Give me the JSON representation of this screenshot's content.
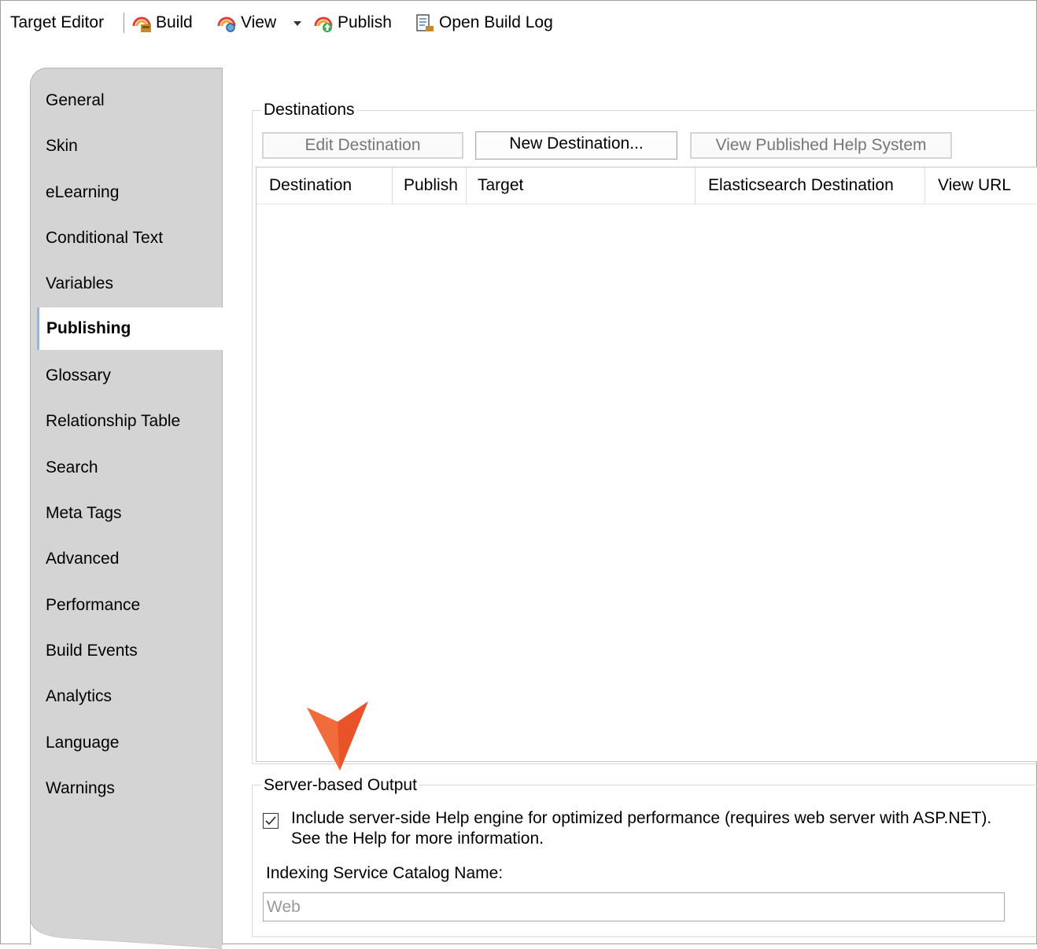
{
  "toolbar": {
    "title": "Target Editor",
    "build": "Build",
    "view": "View",
    "publish": "Publish",
    "open_build_log": "Open Build Log"
  },
  "nav": {
    "items": [
      "General",
      "Skin",
      "eLearning",
      "Conditional Text",
      "Variables",
      "Publishing",
      "Glossary",
      "Relationship Table",
      "Search",
      "Meta Tags",
      "Advanced",
      "Performance",
      "Build Events",
      "Analytics",
      "Language",
      "Warnings"
    ],
    "selected": "Publishing"
  },
  "destinations": {
    "group_label": "Destinations",
    "buttons": {
      "edit": "Edit Destination",
      "new": "New Destination...",
      "view_published": "View Published Help System"
    },
    "columns": [
      "Destination",
      "Publish",
      "Target",
      "Elasticsearch Destination",
      "View URL"
    ],
    "rows": []
  },
  "server_output": {
    "group_label": "Server-based Output",
    "checkbox_checked": true,
    "checkbox_line1": "Include server-side Help engine for optimized performance (requires web server with ASP.NET).",
    "checkbox_line2": "See the Help for more information.",
    "catalog_label": "Indexing Service Catalog Name:",
    "catalog_value": "Web"
  },
  "colors": {
    "callout_arrow": "#e8532a",
    "selected_tab_accent": "#8fb8e0"
  }
}
